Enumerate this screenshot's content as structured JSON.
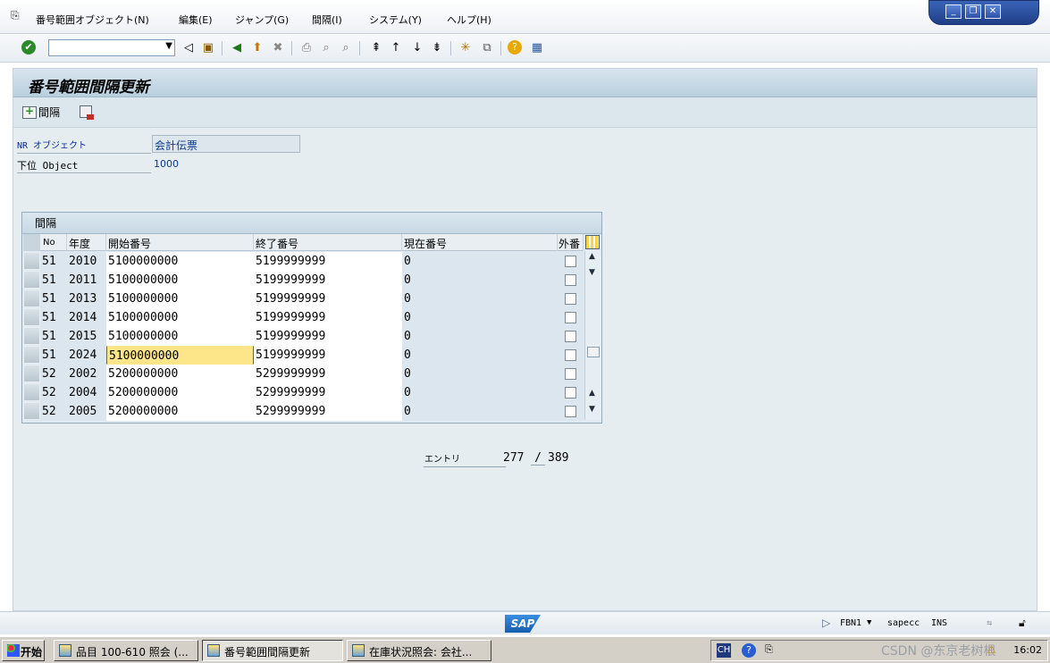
{
  "menu": {
    "items": [
      "番号範囲オブジェクト(N)",
      "編集(E)",
      "ジャンプ(G)",
      "間隔(I)",
      "システム(Y)",
      "ヘルプ(H)"
    ]
  },
  "window_buttons": [
    "_",
    "❐",
    "✕"
  ],
  "toolbar": {
    "command_field_value": "",
    "icons": [
      "check-icon",
      "dropdown-icon",
      "back-arrow-icon",
      "save-icon",
      "back-icon",
      "exit-icon",
      "cancel-icon",
      "print-icon",
      "find-icon",
      "find-next-icon",
      "first-page-icon",
      "prev-page-icon",
      "next-page-icon",
      "last-page-icon",
      "new-session-icon",
      "shortcut-icon",
      "help-icon",
      "layout-icon"
    ]
  },
  "screen": {
    "title": "番号範囲間隔更新",
    "app_toolbar": {
      "interval_button": "間隔"
    },
    "nr_object_label": "NR オブジェクト",
    "nr_object_value": "会計伝票",
    "sub_object_label": "下位 Object",
    "sub_object_value": "1000"
  },
  "table": {
    "caption": "間隔",
    "columns": [
      "No",
      "年度",
      "開始番号",
      "終了番号",
      "現在番号",
      "外番"
    ],
    "rows": [
      {
        "no": "51",
        "year": "2010",
        "start": "5100000000",
        "end": "5199999999",
        "current": "0",
        "ext": false
      },
      {
        "no": "51",
        "year": "2011",
        "start": "5100000000",
        "end": "5199999999",
        "current": "0",
        "ext": false
      },
      {
        "no": "51",
        "year": "2013",
        "start": "5100000000",
        "end": "5199999999",
        "current": "0",
        "ext": false
      },
      {
        "no": "51",
        "year": "2014",
        "start": "5100000000",
        "end": "5199999999",
        "current": "0",
        "ext": false
      },
      {
        "no": "51",
        "year": "2015",
        "start": "5100000000",
        "end": "5199999999",
        "current": "0",
        "ext": false
      },
      {
        "no": "51",
        "year": "2024",
        "start": "5100000000",
        "end": "5199999999",
        "current": "0",
        "ext": false
      },
      {
        "no": "52",
        "year": "2002",
        "start": "5200000000",
        "end": "5299999999",
        "current": "0",
        "ext": false
      },
      {
        "no": "52",
        "year": "2004",
        "start": "5200000000",
        "end": "5299999999",
        "current": "0",
        "ext": false
      },
      {
        "no": "52",
        "year": "2005",
        "start": "5200000000",
        "end": "5299999999",
        "current": "0",
        "ext": false
      }
    ]
  },
  "entry": {
    "label": "エントリ",
    "current": "277",
    "separator": "/",
    "total": "389"
  },
  "statusbar": {
    "logo": "SAP",
    "tcode": "FBN1",
    "server": "sapecc",
    "mode": "INS"
  },
  "taskbar": {
    "start": "开始",
    "tasks": [
      "品目 100-610 照会 (...",
      "番号範囲間隔更新",
      "在庫状況照会: 会社..."
    ],
    "lang": "CH",
    "help": "?",
    "watermark": "CSDN @东京老树根",
    "clock": "16:02"
  }
}
